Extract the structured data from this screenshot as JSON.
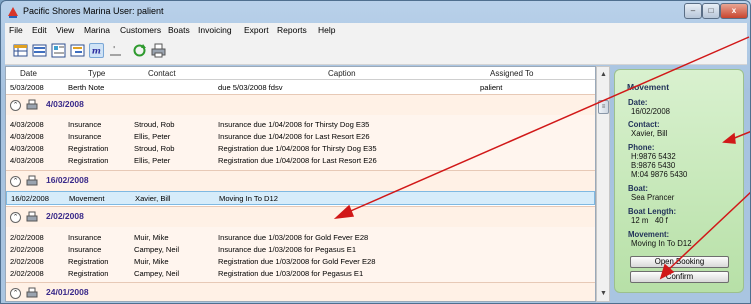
{
  "window": {
    "title": "Pacific Shores Marina  User: palient",
    "controls": {
      "minimize": "–",
      "maximize": "□",
      "close": "x"
    }
  },
  "menu": [
    "File",
    "Edit",
    "View",
    "Marina",
    "Customers",
    "Boats",
    "Invoicing",
    "Export",
    "Reports",
    "Help"
  ],
  "toolbar_icons": [
    "grid-view-icon",
    "list-view-icon",
    "card-view-icon",
    "tree-view-icon",
    "memo-view-icon",
    "timeline-view-icon",
    "refresh-icon",
    "print-icon"
  ],
  "grid": {
    "columns": [
      "Date",
      "Type",
      "Contact",
      "Caption",
      "Assigned To"
    ],
    "top_row": {
      "date": "5/03/2008",
      "type": "Berth Note",
      "contact": "",
      "caption": "due 5/03/2008 fdsv",
      "assigned": "palient"
    },
    "groups": [
      {
        "date": "4/03/2008",
        "rows": [
          {
            "date": "4/03/2008",
            "type": "Insurance",
            "contact": "Stroud, Rob",
            "caption": "Insurance due 1/04/2008 for Thirsty Dog E35"
          },
          {
            "date": "4/03/2008",
            "type": "Insurance",
            "contact": "Ellis, Peter",
            "caption": "Insurance due 1/04/2008 for Last Resort E26"
          },
          {
            "date": "4/03/2008",
            "type": "Registration",
            "contact": "Stroud, Rob",
            "caption": "Registration due 1/04/2008 for Thirsty Dog E35"
          },
          {
            "date": "4/03/2008",
            "type": "Registration",
            "contact": "Ellis, Peter",
            "caption": "Registration due 1/04/2008 for Last Resort E26"
          }
        ]
      },
      {
        "date": "16/02/2008",
        "rows": [
          {
            "date": "16/02/2008",
            "type": "Movement",
            "contact": "Xavier, Bill",
            "caption": "Moving In To D12"
          }
        ]
      },
      {
        "date": "2/02/2008",
        "rows": [
          {
            "date": "2/02/2008",
            "type": "Insurance",
            "contact": "Muir, Mike",
            "caption": "Insurance due 1/03/2008 for Gold Fever E28"
          },
          {
            "date": "2/02/2008",
            "type": "Insurance",
            "contact": "Campey, Neil",
            "caption": "Insurance due 1/03/2008 for Pegasus E1"
          },
          {
            "date": "2/02/2008",
            "type": "Registration",
            "contact": "Muir, Mike",
            "caption": "Registration due 1/03/2008 for Gold Fever E28"
          },
          {
            "date": "2/02/2008",
            "type": "Registration",
            "contact": "Campey, Neil",
            "caption": "Registration due 1/03/2008 for Pegasus E1"
          }
        ]
      },
      {
        "date": "24/01/2008",
        "rows": []
      }
    ]
  },
  "detail": {
    "title": "Movement",
    "date_label": "Date:",
    "date": "16/02/2008",
    "contact_label": "Contact:",
    "contact": "Xavier, Bill",
    "phone_label": "Phone:",
    "phone_h": "H:9876 5432",
    "phone_b": "B:9876 5430",
    "phone_m": "M:04 9876 5430",
    "boat_label": "Boat:",
    "boat": "Sea Prancer",
    "length_label": "Boat Length:",
    "length": "12 m   40 f",
    "movement_label": "Movement:",
    "movement": "Moving In To D12",
    "open_button": "Open Booking",
    "confirm_button": "Confirm"
  },
  "colors": {
    "group_date": "#3a2a8a",
    "detail_bg": "#c3e6b4",
    "arrow": "#d11818",
    "selection": "#d6ecfa"
  }
}
